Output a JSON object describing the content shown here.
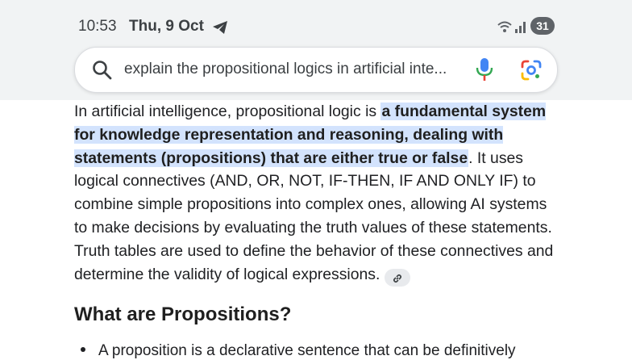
{
  "status_bar": {
    "time": "10:53",
    "date": "Thu, 9 Oct",
    "battery": "31",
    "icons": [
      "telegram-icon",
      "wifi-icon",
      "signal-icon",
      "battery-icon"
    ]
  },
  "search": {
    "query": "explain the propositional logics in artificial inte...",
    "icons": [
      "search-icon",
      "mic-icon",
      "google-lens-icon"
    ]
  },
  "answer": {
    "intro": "In artificial intelligence, propositional logic is ",
    "highlight": "a fundamental system for knowledge representation and reasoning, dealing with statements (propositions) that are either true or false",
    "rest": ". It uses logical connectives (AND, OR, NOT, IF-THEN, IF AND ONLY IF) to combine simple propositions into complex ones, allowing AI systems to make decisions by evaluating the truth values of these statements. Truth tables are used to define the behavior of these connectives and determine the validity of logical expressions.",
    "link_icon": "link-icon"
  },
  "section": {
    "heading": "What are Propositions?",
    "bullets": [
      "A proposition is a declarative sentence that can be definitively"
    ]
  },
  "colors": {
    "highlight": "#d3e3fd",
    "mic_blue": "#4285f4",
    "mic_red": "#ea4335",
    "chip": "#e8eaed"
  }
}
